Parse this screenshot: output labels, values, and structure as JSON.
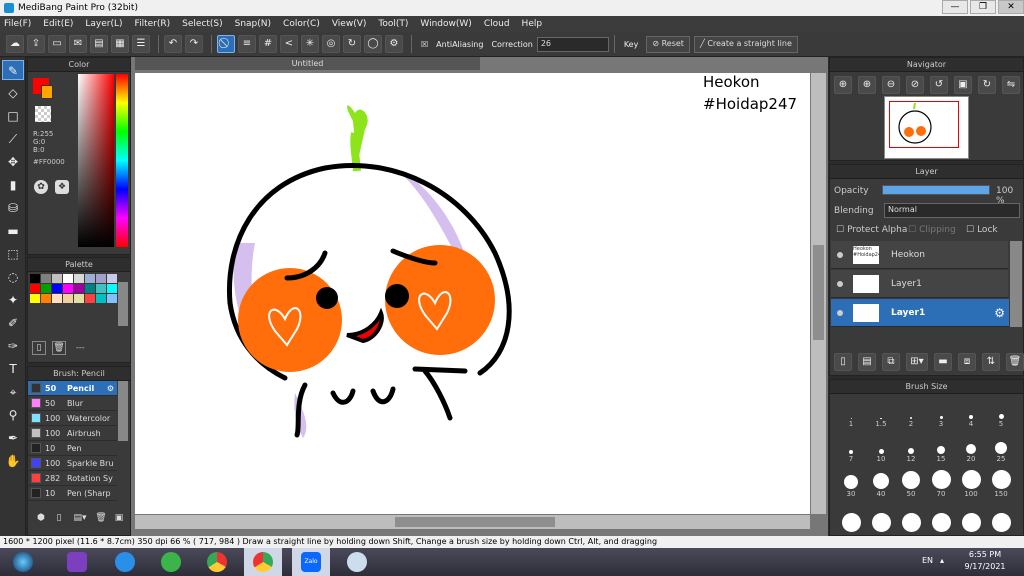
{
  "window": {
    "title": "MediBang Paint Pro (32bit)",
    "min": "—",
    "max": "❐",
    "close": "✕"
  },
  "menu": [
    "File(F)",
    "Edit(E)",
    "Layer(L)",
    "Filter(R)",
    "Select(S)",
    "Snap(N)",
    "Color(C)",
    "View(V)",
    "Tool(T)",
    "Window(W)",
    "Cloud",
    "Help"
  ],
  "toolbar": {
    "antialiasing_label": "AntiAliasing",
    "correction_label": "Correction",
    "correction_value": "26",
    "key_label": "Key",
    "reset_label": "Reset",
    "straight_line_label": "Create a straight line"
  },
  "color_panel": {
    "title": "Color",
    "r": "R:255",
    "g": "G:0",
    "b": "B:0",
    "hex": "#FF0000",
    "foreground": "#ff0000",
    "background": "#ffa500"
  },
  "palette_panel": {
    "title": "Palette",
    "more": "---",
    "swatches": [
      "#000000",
      "#808080",
      "#c0c0c0",
      "#ffffff",
      "#d8d8d8",
      "#9ab0d8",
      "#a0a0c8",
      "#c8c8e8",
      "#ff0000",
      "#00a000",
      "#0000ff",
      "#ff00ff",
      "#a000a0",
      "#008080",
      "#40c0c0",
      "#00ffff",
      "#ffff00",
      "#ff8000",
      "#ffe0c0",
      "#f0d0a0",
      "#e0e0a0",
      "#ff4040",
      "#00c0c0",
      "#80c0ff"
    ]
  },
  "brush_panel": {
    "title": "Brush: Pencil",
    "brushes": [
      {
        "size": "50",
        "name": "Pencil",
        "color": "#333333"
      },
      {
        "size": "50",
        "name": "Blur",
        "color": "#ff80ff"
      },
      {
        "size": "100",
        "name": "Watercolor",
        "color": "#80e0ff"
      },
      {
        "size": "100",
        "name": "Airbrush",
        "color": "#c0c0c0"
      },
      {
        "size": "10",
        "name": "Pen",
        "color": "#222222"
      },
      {
        "size": "100",
        "name": "Sparkle Bru",
        "color": "#4040ff"
      },
      {
        "size": "282",
        "name": "Rotation Sy",
        "color": "#ff4040"
      },
      {
        "size": "10",
        "name": "Pen (Sharp",
        "color": "#222222"
      }
    ]
  },
  "canvas": {
    "tab": "Untitled",
    "watermark_line1": "Heokon",
    "watermark_line2": "#Hoidap247"
  },
  "navigator": {
    "title": "Navigator"
  },
  "layer_panel": {
    "title": "Layer",
    "opacity_label": "Opacity",
    "opacity_value": "100 %",
    "opacity_fraction": 1.0,
    "blending_label": "Blending",
    "blending_value": "Normal",
    "protect_alpha": "Protect Alpha",
    "clipping": "Clipping",
    "lock": "Lock",
    "layers": [
      {
        "name": "Heokon",
        "thumb_text": "Heokon #Hoidap247"
      },
      {
        "name": "Layer1",
        "thumb_text": ""
      },
      {
        "name": "Layer1",
        "thumb_text": ""
      }
    ]
  },
  "brush_size_panel": {
    "title": "Brush Size",
    "sizes": [
      "1",
      "1.5",
      "2",
      "3",
      "4",
      "5",
      "7",
      "10",
      "12",
      "15",
      "20",
      "25",
      "30",
      "40",
      "50",
      "70",
      "100",
      "150",
      "",
      "",
      "",
      "",
      "",
      ""
    ]
  },
  "status_bar": {
    "text": "1600 * 1200 pixel   (11.6 * 8.7cm)   350 dpi   66 %   ( 717, 984 )   Draw a straight line by holding down Shift, Change a brush size by holding down Ctrl, Alt, and dragging"
  },
  "taskbar": {
    "lang": "EN",
    "time": "6:55 PM",
    "date": "9/17/2021",
    "zalo_label": "Zalo"
  }
}
